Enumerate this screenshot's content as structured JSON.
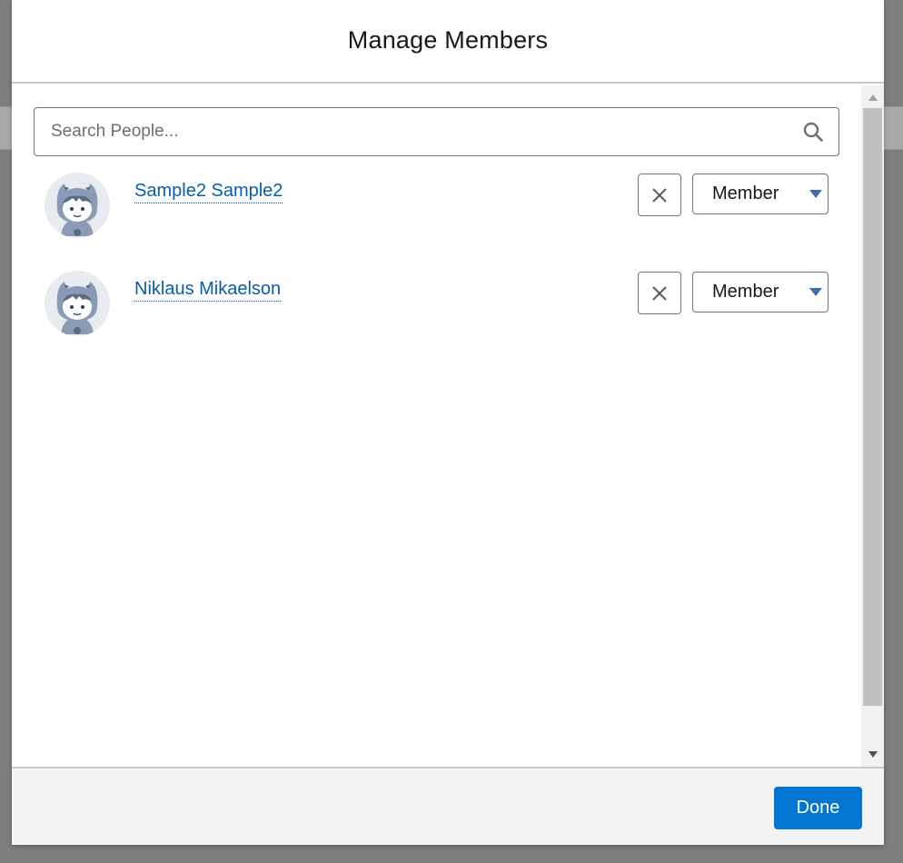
{
  "modal": {
    "title": "Manage Members"
  },
  "search": {
    "placeholder": "Search People...",
    "value": ""
  },
  "members": [
    {
      "name": "Sample2 Sample2",
      "role": "Member"
    },
    {
      "name": "Niklaus Mikaelson",
      "role": "Member"
    }
  ],
  "footer": {
    "done_label": "Done"
  },
  "colors": {
    "brand_button": "#0176d3",
    "link": "#0b5cab",
    "backdrop": "#7e7e7e"
  },
  "icons": {
    "search": "search-icon",
    "remove": "close-icon",
    "avatar": "default-user-avatar-icon",
    "dropdown": "chevron-down-icon"
  }
}
